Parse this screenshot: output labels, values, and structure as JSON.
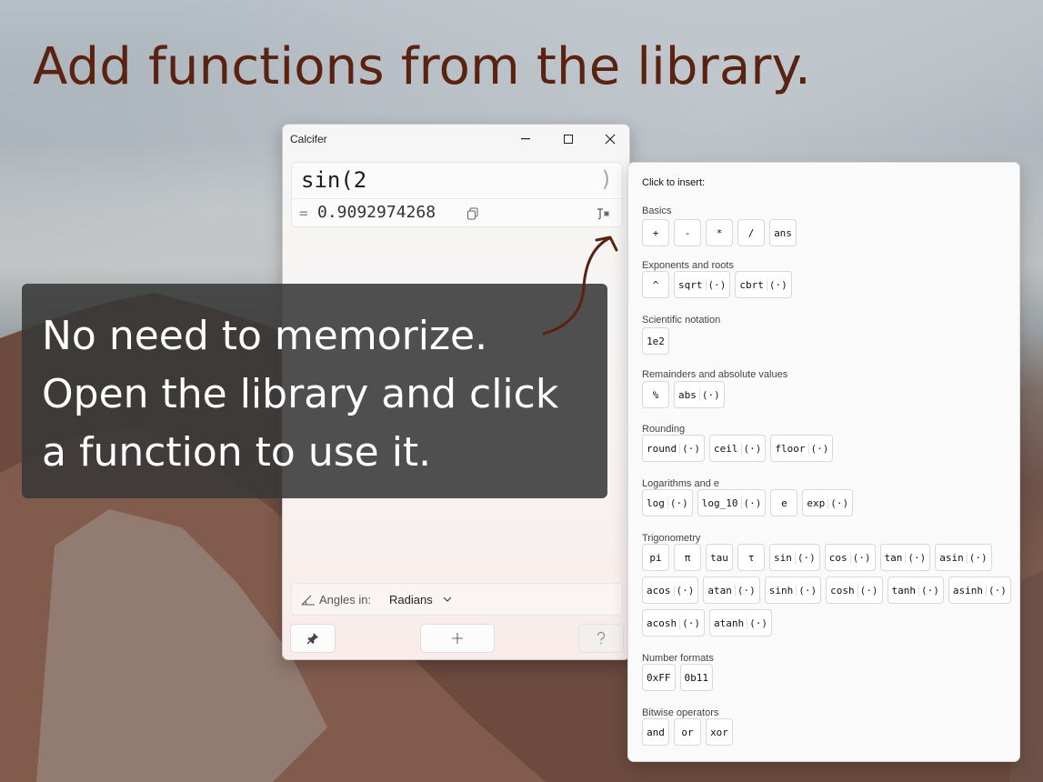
{
  "headline": "Add functions from the library.",
  "window": {
    "title": "Calcifer",
    "expression": "sin(2",
    "auto_close": ")",
    "result_prefix": "=",
    "result": "0.9092974268",
    "angles_label": "Angles in:",
    "angles_value": "Radians"
  },
  "callout": {
    "lines": [
      "No need to memorize.",
      "Open the library and click",
      "a function to use it."
    ]
  },
  "library": {
    "header": "Click to insert:",
    "categories": [
      {
        "label": "Basics",
        "rows": [
          [
            {
              "n": "+"
            },
            {
              "n": "-"
            },
            {
              "n": "*"
            },
            {
              "n": "/"
            },
            {
              "n": "ans"
            }
          ]
        ]
      },
      {
        "label": "Exponents and roots",
        "rows": [
          [
            {
              "n": "^"
            },
            {
              "n": "sqrt",
              "a": "(·)"
            },
            {
              "n": "cbrt",
              "a": "(·)"
            }
          ]
        ]
      },
      {
        "label": "Scientific notation",
        "rows": [
          [
            {
              "n": "1e2"
            }
          ]
        ]
      },
      {
        "label": "Remainders and absolute values",
        "rows": [
          [
            {
              "n": "%"
            },
            {
              "n": "abs",
              "a": "(·)"
            }
          ]
        ]
      },
      {
        "label": "Rounding",
        "rows": [
          [
            {
              "n": "round",
              "a": "(·)"
            },
            {
              "n": "ceil",
              "a": "(·)"
            },
            {
              "n": "floor",
              "a": "(·)"
            }
          ]
        ]
      },
      {
        "label": "Logarithms and e",
        "rows": [
          [
            {
              "n": "log",
              "a": "(·)"
            },
            {
              "n": "log_10",
              "a": "(·)"
            },
            {
              "n": "e"
            },
            {
              "n": "exp",
              "a": "(·)"
            }
          ]
        ]
      },
      {
        "label": "Trigonometry",
        "rows": [
          [
            {
              "n": "pi"
            },
            {
              "n": "π"
            },
            {
              "n": "tau"
            },
            {
              "n": "τ"
            },
            {
              "n": "sin",
              "a": "(·)"
            },
            {
              "n": "cos",
              "a": "(·)"
            },
            {
              "n": "tan",
              "a": "(·)"
            },
            {
              "n": "asin",
              "a": "(·)"
            }
          ],
          [
            {
              "n": "acos",
              "a": "(·)"
            },
            {
              "n": "atan",
              "a": "(·)"
            },
            {
              "n": "sinh",
              "a": "(·)"
            },
            {
              "n": "cosh",
              "a": "(·)"
            },
            {
              "n": "tanh",
              "a": "(·)"
            },
            {
              "n": "asinh",
              "a": "(·)"
            }
          ],
          [
            {
              "n": "acosh",
              "a": "(·)"
            },
            {
              "n": "atanh",
              "a": "(·)"
            }
          ]
        ]
      },
      {
        "label": "Number formats",
        "rows": [
          [
            {
              "n": "0xFF"
            },
            {
              "n": "0b11"
            }
          ]
        ]
      },
      {
        "label": "Bitwise operators",
        "rows": [
          [
            {
              "n": "and"
            },
            {
              "n": "or"
            },
            {
              "n": "xor"
            }
          ]
        ]
      }
    ]
  },
  "colors": {
    "headline": "#5a2210",
    "callout_bg": "#383838",
    "arrow": "#5a2210"
  }
}
